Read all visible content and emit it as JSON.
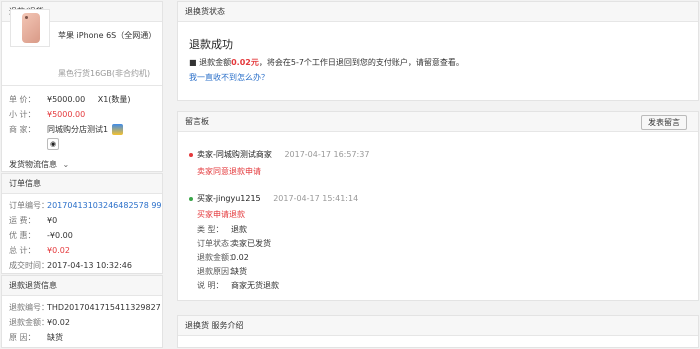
{
  "left": {
    "refund_header": "退款/退货",
    "product": {
      "name": "苹果 iPhone 6S（全网通）",
      "spec": "黑色行货16GB(非合约机)"
    },
    "price": {
      "label": "单    价：",
      "value": "¥5000.00",
      "qty": "X1(数量)"
    },
    "subtotal": {
      "label": "小    计：",
      "value": "¥5000.00"
    },
    "seller": {
      "label": "商    家：",
      "value": "同城购分店测试1"
    },
    "shipping_info": "发货物流信息",
    "order_header": "订单信息",
    "order": [
      {
        "label": "订单编号：",
        "value": "20170413103246482578 99"
      },
      {
        "label": "运    费：",
        "value": "¥0"
      },
      {
        "label": "优 惠：",
        "value": "-¥0.00"
      },
      {
        "label": "总    计：",
        "value": "¥0.02"
      },
      {
        "label": "成交时间：",
        "value": "2017-04-13 10:32:46"
      }
    ],
    "refund_info_header": "退款退货信息",
    "refund_info": [
      {
        "label": "退款编号：",
        "value": "THD2017041715411329827"
      },
      {
        "label": "退款金额：",
        "value": "¥0.02"
      },
      {
        "label": "原    因：",
        "value": "缺货"
      }
    ]
  },
  "status": {
    "header": "退换货状态",
    "title": "退款成功",
    "msg_prefix": "退款金额",
    "amount": "0.02元",
    "msg_suffix": "，将会在5-7个工作日退回到您的支付账户，请留意查看。",
    "link": "我一直收不到怎么办？"
  },
  "board": {
    "header": "留言板",
    "post_button": "发表留言",
    "messages": [
      {
        "author": "卖家-同城购测试商家",
        "time": "2017-04-17 16:57:37",
        "body": "卖家同意退款申请",
        "dot_color": "#e4393c"
      },
      {
        "author": "买家-jingyu1215",
        "time": "2017-04-17 15:41:14",
        "body": "买家申请退款",
        "dot_color": "#3aa64a"
      }
    ],
    "details": [
      {
        "label": "类    型：",
        "value": "退款"
      },
      {
        "label": "订单状态：",
        "value": "卖家已发货"
      },
      {
        "label": "退款金额：",
        "value": "0.02"
      },
      {
        "label": "退款原因：",
        "value": "缺货"
      },
      {
        "label": "说    明：",
        "value": "商家无货退款"
      }
    ]
  },
  "service": {
    "header": "退换货 服务介绍"
  }
}
